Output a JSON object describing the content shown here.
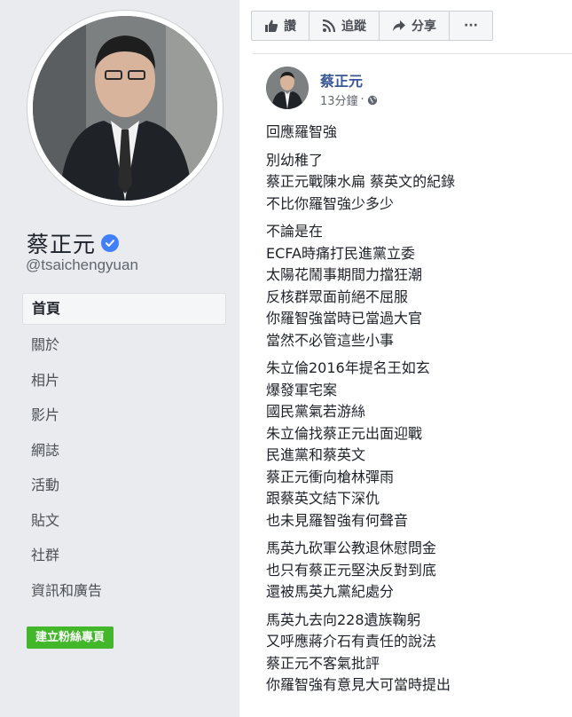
{
  "sidebar": {
    "page_name": "蔡正元",
    "handle": "@tsaichengyuan",
    "nav_items": [
      "首頁",
      "關於",
      "相片",
      "影片",
      "網誌",
      "活動",
      "貼文",
      "社群",
      "資訊和廣告"
    ],
    "create_page_label": "建立粉絲專頁"
  },
  "actions": {
    "like": "讚",
    "follow": "追蹤",
    "share": "分享",
    "more": "···"
  },
  "post": {
    "author": "蔡正元",
    "time": "13分鐘",
    "paragraphs": [
      [
        "回應羅智強"
      ],
      [
        "別幼稚了",
        "蔡正元戰陳水扁 蔡英文的紀錄",
        "不比你羅智強少多少"
      ],
      [
        "不論是在",
        "ECFA時痛打民進黨立委",
        "太陽花鬧事期間力擋狂潮",
        "反核群眾面前絕不屈服",
        "你羅智強當時已當過大官",
        "當然不必管這些小事"
      ],
      [
        "朱立倫2016年提名王如玄",
        "爆發軍宅案",
        "國民黨氣若游絲",
        "朱立倫找蔡正元出面迎戰",
        "民進黨和蔡英文",
        "蔡正元衝向槍林彈雨",
        "跟蔡英文結下深仇",
        "也未見羅智強有何聲音"
      ],
      [
        "馬英九砍軍公教退休慰問金",
        "也只有蔡正元堅決反對到底",
        "還被馬英九黨紀處分"
      ],
      [
        "馬英九去向228遺族鞠躬",
        "又呼應蔣介石有責任的說法",
        "蔡正元不客氣批評",
        "你羅智強有意見大可當時提出"
      ]
    ]
  },
  "colors": {
    "accent_link": "#385898",
    "verified": "#4080ff",
    "create_button": "#42b72a",
    "page_bg": "#e9ebee"
  }
}
